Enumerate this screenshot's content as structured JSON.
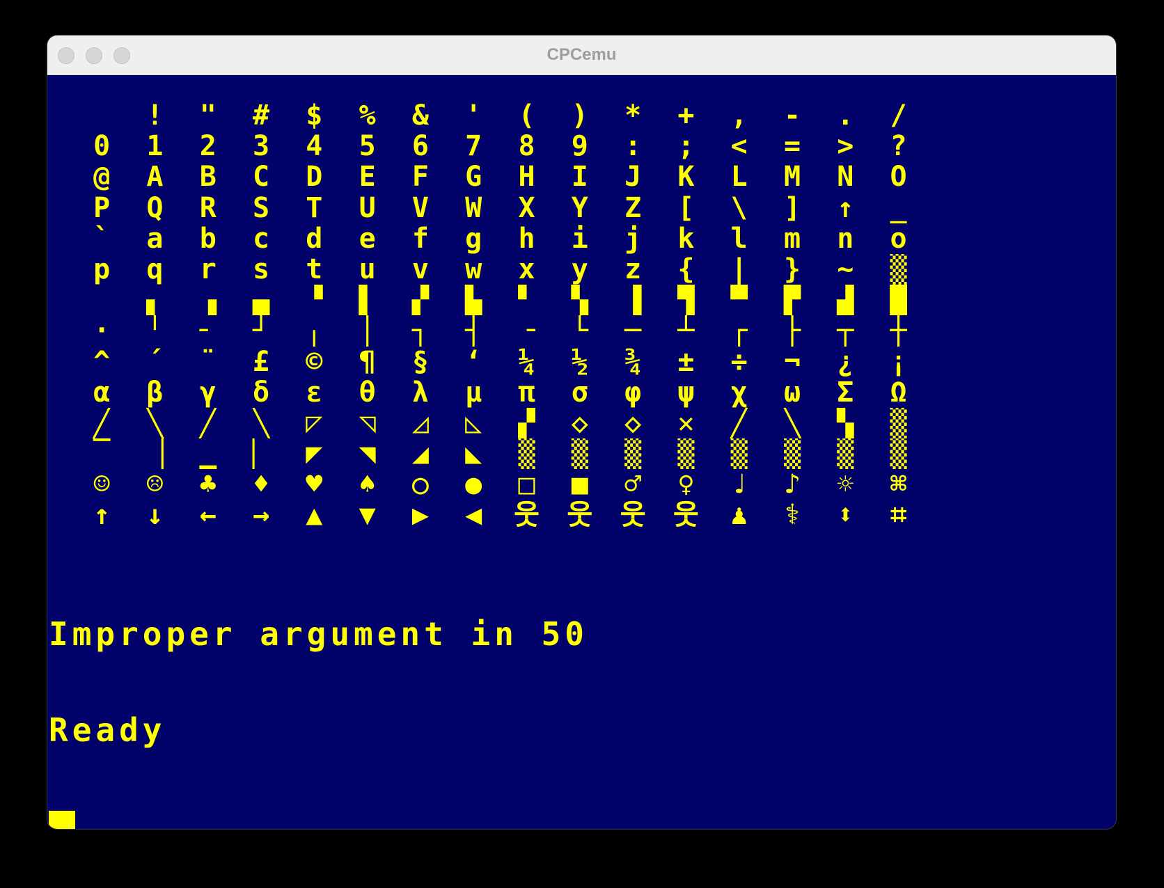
{
  "window": {
    "title": "CPCemu"
  },
  "colors": {
    "screen_background": "#02026b",
    "text": "#ffff00",
    "titlebar": "#efefef",
    "title_text": "#9e9e9e",
    "desktop": "#000000"
  },
  "charmap": {
    "rows": [
      [
        " ",
        "!",
        "\"",
        "#",
        "$",
        "%",
        "&",
        "'",
        "(",
        ")",
        "*",
        "+",
        ",",
        "-",
        ".",
        "/"
      ],
      [
        "0",
        "1",
        "2",
        "3",
        "4",
        "5",
        "6",
        "7",
        "8",
        "9",
        ":",
        ";",
        "<",
        "=",
        ">",
        "?"
      ],
      [
        "@",
        "A",
        "B",
        "C",
        "D",
        "E",
        "F",
        "G",
        "H",
        "I",
        "J",
        "K",
        "L",
        "M",
        "N",
        "O"
      ],
      [
        "P",
        "Q",
        "R",
        "S",
        "T",
        "U",
        "V",
        "W",
        "X",
        "Y",
        "Z",
        "[",
        "\\",
        "]",
        "↑",
        "_"
      ],
      [
        "`",
        "a",
        "b",
        "c",
        "d",
        "e",
        "f",
        "g",
        "h",
        "i",
        "j",
        "k",
        "l",
        "m",
        "n",
        "o"
      ],
      [
        "p",
        "q",
        "r",
        "s",
        "t",
        "u",
        "v",
        "w",
        "x",
        "y",
        "z",
        "{",
        "|",
        "}",
        "~",
        "▒"
      ],
      [
        " ",
        "▖",
        "▗",
        "▄",
        "▝",
        "▌",
        "▞",
        "▙",
        "▘",
        "▚",
        "▐",
        "▜",
        "▀",
        "▛",
        "▟",
        "█"
      ],
      [
        "·",
        "╵",
        "╴",
        "┘",
        "╷",
        "│",
        "┐",
        "┤",
        "╶",
        "└",
        "─",
        "┴",
        "┌",
        "├",
        "┬",
        "┼"
      ],
      [
        "^",
        "´",
        "¨",
        "£",
        "©",
        "¶",
        "§",
        "‘",
        "¼",
        "½",
        "¾",
        "±",
        "÷",
        "¬",
        "¿",
        "¡"
      ],
      [
        "α",
        "β",
        "γ",
        "δ",
        "ε",
        "θ",
        "λ",
        "μ",
        "π",
        "σ",
        "φ",
        "ψ",
        "χ",
        "ω",
        "Σ",
        "Ω"
      ],
      [
        "╱",
        "╲",
        "╱",
        "╲",
        "◸",
        "◹",
        "◿",
        "◺",
        "▞",
        "◇",
        "◇",
        "✕",
        "╱",
        "╲",
        "▚",
        "▒"
      ],
      [
        "▔",
        "▕",
        "▁",
        "▏",
        "◤",
        "◥",
        "◢",
        "◣",
        "▒",
        "▒",
        "▒",
        "▒",
        "▒",
        "▒",
        "▒",
        "▒"
      ],
      [
        "☺",
        "☹",
        "♣",
        "♦",
        "♥",
        "♠",
        "○",
        "●",
        "□",
        "■",
        "♂",
        "♀",
        "♩",
        "♪",
        "☼",
        "⌘"
      ],
      [
        "↑",
        "↓",
        "←",
        "→",
        "▲",
        "▼",
        "▶",
        "◀",
        "웃",
        "웃",
        "웃",
        "웃",
        "♟",
        "⚕",
        "⬍",
        "⌗"
      ]
    ]
  },
  "console": {
    "lines": [
      "Improper argument in 50",
      "Ready"
    ]
  }
}
